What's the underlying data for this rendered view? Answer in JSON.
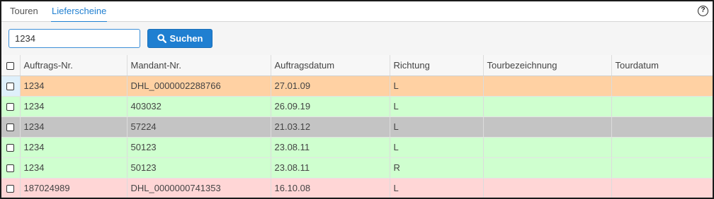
{
  "tabs": [
    {
      "label": "Touren",
      "active": false
    },
    {
      "label": "Lieferscheine",
      "active": true
    }
  ],
  "help": {
    "icon": "help-circle-icon",
    "glyph": "?"
  },
  "search": {
    "value": "1234",
    "button_label": "Suchen",
    "button_icon": "search-icon"
  },
  "table": {
    "headers": [
      "Auftrags-Nr.",
      "Mandant-Nr.",
      "Auftragsdatum",
      "Richtung",
      "Tourbezeichnung",
      "Tourdatum"
    ],
    "rows": [
      {
        "status": "orange",
        "cells": [
          "1234",
          "DHL_0000002288766",
          "27.01.09",
          "L",
          "",
          ""
        ]
      },
      {
        "status": "green",
        "cells": [
          "1234",
          "403032",
          "26.09.19",
          "L",
          "",
          ""
        ]
      },
      {
        "status": "grey",
        "cells": [
          "1234",
          "57224",
          "21.03.12",
          "L",
          "",
          ""
        ]
      },
      {
        "status": "green",
        "cells": [
          "1234",
          "50123",
          "23.08.11",
          "L",
          "",
          ""
        ]
      },
      {
        "status": "green",
        "cells": [
          "1234",
          "50123",
          "23.08.11",
          "R",
          "",
          ""
        ]
      },
      {
        "status": "red",
        "cells": [
          "187024989",
          "DHL_0000000741353",
          "16.10.08",
          "L",
          "",
          ""
        ]
      }
    ]
  },
  "colors": {
    "accent": "#1f7fd1",
    "row_orange": "#ffd1a3",
    "row_green": "#cfffcf",
    "row_grey": "#c4c4c4",
    "row_red": "#ffd6d6"
  }
}
